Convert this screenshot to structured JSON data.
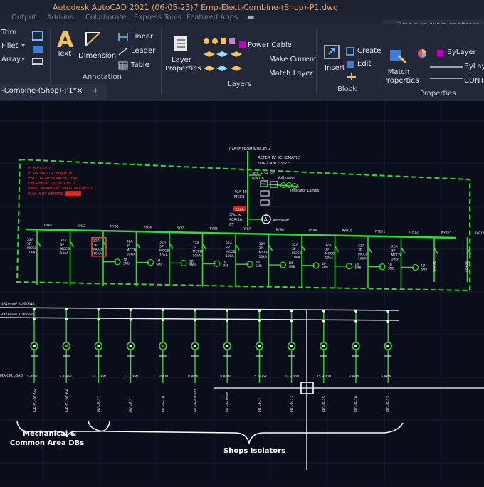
{
  "window": {
    "title": "Autodesk AutoCAD 2021   (06-05-23)7 Emp-Elect-Combine-(Shop)-P1.dwg",
    "search_placeholder": "Type a keyword or phrase"
  },
  "menu_tabs": [
    "Output",
    "Add-ins",
    "Collaborate",
    "Express Tools",
    "Featured Apps"
  ],
  "ribbon": {
    "modify": {
      "trim": "Trim",
      "fillet": "Fillet",
      "array": "Array"
    },
    "annotation": {
      "text": "Text",
      "dimension": "Dimension",
      "linear": "Linear",
      "leader": "Leader",
      "table": "Table",
      "group_label": "Annotation"
    },
    "layers": {
      "layer_properties": "Layer Properties",
      "current_layer": "Power Cable",
      "make_current": "Make Current",
      "match_layer": "Match Layer",
      "group_label": "Layers"
    },
    "block": {
      "insert": "Insert",
      "create": "Create",
      "edit": "Edit",
      "group_label": "Block"
    },
    "properties": {
      "match_properties": "Match Properties",
      "color": "ByLayer",
      "linetype": "ByLayer",
      "lineweight": "CONTI",
      "group_label": "Properties"
    }
  },
  "document_tab": {
    "label": "-Combine-(Shop)-P1*",
    "close": "×"
  },
  "drawing": {
    "header_lines": [
      "CABLE FROM MDB-P1-4",
      "REFER LV SCHEMATIC",
      "FOR CABLE SIZE"
    ],
    "notes": [
      "FDB-P1-SF-2",
      "FORM FACTOR: FORM 2b",
      "ENCLOSURE IP RATING: IP42",
      "DEGREE OF POLLUTION: 2",
      "PANEL MOUNTING: WALL MOUNTED",
      "MAX.M.UV DEMAND: 36.5kW"
    ],
    "spd": [
      "3ph + SA SP",
      "8/A CB"
    ],
    "voltmeter": "Voltmeter",
    "indicator_lamps": "Indicator Lamps",
    "incomer": [
      "40A 4P",
      "MCCB",
      "25kA"
    ],
    "ct": [
      "3No. x",
      "40A/5A",
      "CT"
    ],
    "ammeter": "Ammeter",
    "outgoing_ways": [
      {
        "ry": "RYB1",
        "rating": "32A\n3P\nMCCB\n10kA",
        "load": "5.0kW",
        "feeder": "DB-P1-SF-G2"
      },
      {
        "ry": "RYB2",
        "rating": "32A\n3P\nMCCB\n10kA",
        "load": "5.76kW",
        "feeder": "DB-P1-SF-A2"
      },
      {
        "ry": "RYB3",
        "rating": "32A\n3P\nMCCB\n10kA",
        "load": "21.72kW",
        "feeder": "RO-IP-17"
      },
      {
        "ry": "RYB4",
        "rating": "32A\n3P\nMCCB\n10kA",
        "load": "12.72kW",
        "feeder": "RO-IP-11"
      },
      {
        "ry": "RYB5",
        "rating": "32A\n3P\nMCCB\n10kA",
        "load": "7.35kW",
        "feeder": "RO-IP-10"
      },
      {
        "ry": "RYB6",
        "rating": "32A\n3P\nMCCB\n10kA",
        "load": "8.8kW",
        "feeder": "RO-IP-Chiller"
      },
      {
        "ry": "RYB7",
        "rating": "32A\n3P\nMCCB\n10kA",
        "load": "8.8kW",
        "feeder": "RO-IP-Toilet"
      },
      {
        "ry": "RYB8",
        "rating": "32A\n3P\nMCCB\n10kA",
        "load": "15.54kW",
        "feeder": "RO-IP-3"
      },
      {
        "ry": "RYB9",
        "rating": "32A\n3P\nMCCB\n10kA",
        "load": "11.22kW",
        "feeder": "RO-IP-13"
      },
      {
        "ry": "RYB10",
        "rating": "32A\n3P\nMCCB\n10kA",
        "load": "15.83kW",
        "feeder": "RO-IP-25"
      },
      {
        "ry": "RYB11",
        "rating": "32A\n3P\nMCCB\n10kA",
        "load": "8.8kW",
        "feeder": "RO-IP-20"
      },
      {
        "ry": "RYB12",
        "rating": "32A\n3P\nMCCB\n10kA",
        "load": "5.8kW",
        "feeder": "RO-IP-23"
      },
      {
        "ry": "RYB13",
        "rating": "SPARE",
        "load": "",
        "feeder": ""
      },
      {
        "ry": "RYB14",
        "rating": "SPARE",
        "load": "",
        "feeder": ""
      }
    ],
    "meter_label": "1Ø\nSMB",
    "cable_labels": [
      "4X16mm² XLPE/SWA",
      "4X16mm² XLPE/SWA"
    ],
    "row_label": "MAX.M.LOAD",
    "brace_left": "Mechanical &\nCommon Area DBs",
    "brace_right": "Shops Isolators"
  }
}
